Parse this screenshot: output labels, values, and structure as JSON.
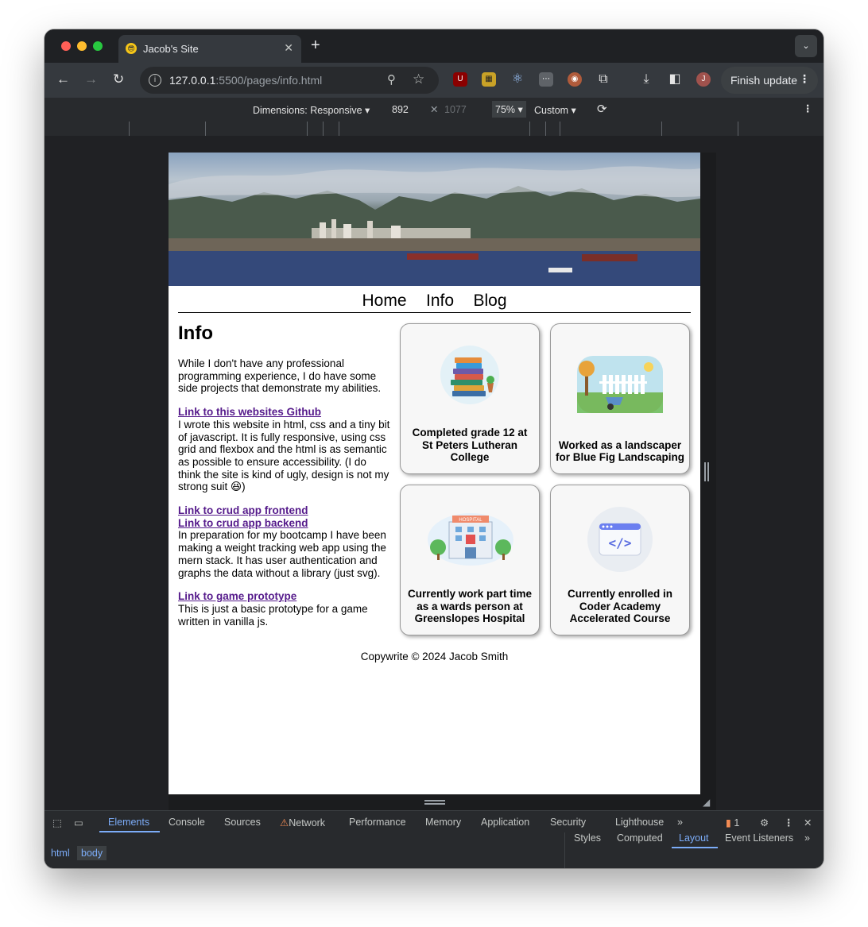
{
  "browser": {
    "tab_title": "Jacob's Site",
    "url_host": "127.0.0.1",
    "url_rest": ":5500/pages/info.html",
    "finish_update_label": "Finish update",
    "profile_initial": "J"
  },
  "device_toolbar": {
    "dimensions_label": "Dimensions: Responsive",
    "width": "892",
    "height_placeholder": "1077",
    "zoom": "75%",
    "throttle": "Custom"
  },
  "site": {
    "nav": [
      "Home",
      "Info",
      "Blog"
    ],
    "heading": "Info",
    "intro": "While I don't have any professional programming experience, I do have some side projects that demonstrate my abilities.",
    "link_github": "Link to this websites Github",
    "github_desc": "I wrote this website in html, css and a tiny bit of javascript. It is fully responsive, using css grid and flexbox and the html is as semantic as possible to ensure accessibility. (I do think the site is kind of ugly, design is not my strong suit 😆)",
    "link_crud_frontend": "Link to crud app frontend",
    "link_crud_backend": "Link to crud app backend",
    "crud_desc": "In preparation for my bootcamp I have been making a weight tracking web app using the mern stack. It has user authentication and graphs the data without a library (just svg).",
    "link_game": "Link to game prototype",
    "game_desc": "This is just a basic prototype for a game written in vanilla js.",
    "cards": [
      {
        "caption": "Completed grade 12 at St Peters Lutheran College",
        "icon": "books-icon"
      },
      {
        "caption": "Worked as a landscaper for Blue Fig Landscaping",
        "icon": "garden-icon"
      },
      {
        "caption": "Currently work part time as a wards person at Greenslopes Hospital",
        "icon": "hospital-icon"
      },
      {
        "caption": "Currently enrolled in Coder Academy Accelerated Course",
        "icon": "code-window-icon"
      }
    ],
    "hospital_sign": "HOSPITAL",
    "code_glyph": "</>",
    "footer": "Copywrite © 2024 Jacob Smith"
  },
  "devtools": {
    "tabs": [
      "Elements",
      "Console",
      "Sources",
      "Network",
      "Performance",
      "Memory",
      "Application",
      "Security",
      "Lighthouse"
    ],
    "issue_count": "1",
    "breadcrumbs": [
      "html",
      "body"
    ],
    "side_tabs": [
      "Styles",
      "Computed",
      "Layout",
      "Event Listeners"
    ]
  },
  "colors": {
    "link": "#551a8b",
    "devtools_active": "#7cacf8"
  }
}
